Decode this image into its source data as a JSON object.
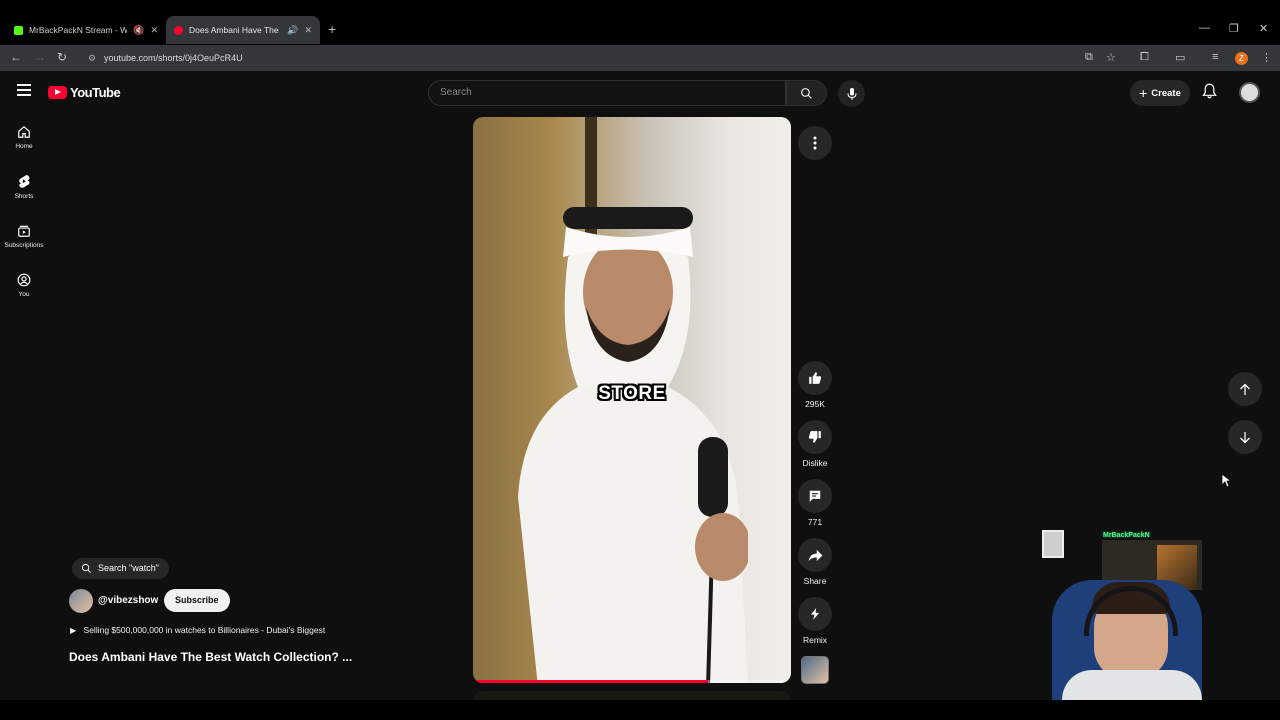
{
  "browser": {
    "tabs": [
      {
        "title": "MrBackPackN Stream - Watch",
        "favicon_color": "#53fc18",
        "active": false
      },
      {
        "title": "Does Ambani Have The Best",
        "favicon_color": "#ff0033",
        "active": true
      }
    ],
    "url": "youtube.com/shorts/0j4OeuPcR4U",
    "profile_badge": "Z"
  },
  "header": {
    "logo_text": "YouTube",
    "search_placeholder": "Search",
    "create_label": "Create"
  },
  "sidebar": {
    "items": [
      {
        "label": "Home",
        "icon": "home-icon"
      },
      {
        "label": "Shorts",
        "icon": "shorts-icon"
      },
      {
        "label": "Subscriptions",
        "icon": "subscriptions-icon"
      },
      {
        "label": "You",
        "icon": "you-icon"
      }
    ]
  },
  "short": {
    "search_chip": "Search \"watch\"",
    "channel": "@vibezshow",
    "subscribe_label": "Subscribe",
    "playlist_line": "Selling $500,000,000 in watches to Billionaires - Dubai's Biggest",
    "title": "Does Ambani Have The Best Watch Collection? ...",
    "caption": "STORE",
    "progress": 0.74,
    "likes": "295K",
    "dislike_label": "Dislike",
    "comments": "771",
    "share_label": "Share",
    "remix_label": "Remix"
  },
  "overlay": {
    "streamer_label": "MrBackPackN"
  },
  "colors": {
    "accent": "#ff0033",
    "background": "#0f0f0f",
    "chip": "#272727"
  }
}
